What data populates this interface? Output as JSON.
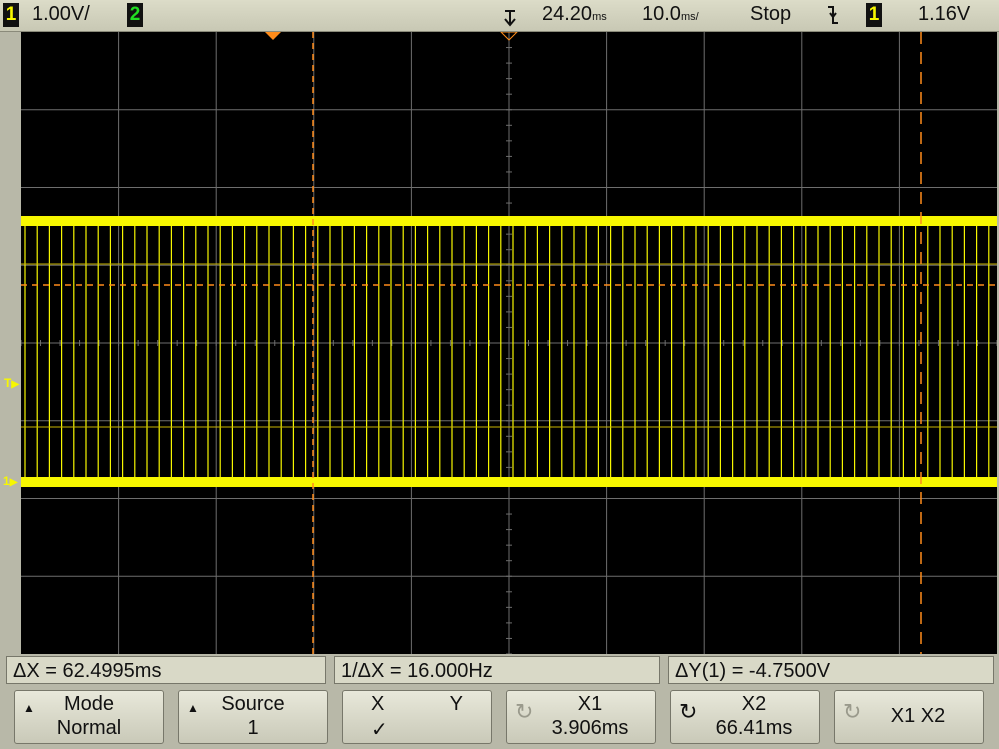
{
  "topbar": {
    "ch1_number": "1",
    "ch1_scale": "1.00V/",
    "ch2_number": "2",
    "trigger_delay": "24.20",
    "trigger_delay_unit": "ms",
    "timebase": "10.0",
    "timebase_unit": "ms/",
    "run_state": "Stop",
    "trigger_source": "1",
    "trigger_level": "1.16V"
  },
  "screen": {
    "trigger_marker": "T",
    "ground_marker": "1"
  },
  "measurements": {
    "delta_x": "ΔX = 62.4995ms",
    "inv_delta_x": "1/ΔX = 16.000Hz",
    "delta_y": "ΔY(1) = -4.7500V"
  },
  "softkeys": {
    "mode": {
      "label": "Mode",
      "value": "Normal"
    },
    "source": {
      "label": "Source",
      "value": "1"
    },
    "xy": {
      "x_label": "X",
      "y_label": "Y",
      "check": "✓"
    },
    "x1": {
      "label": "X1",
      "value": "3.906ms"
    },
    "x2": {
      "label": "X2",
      "value": "66.41ms"
    },
    "x1x2": {
      "label": "X1 X2"
    }
  },
  "colors": {
    "trace": "#f7f700",
    "cursor": "#ff8c1a",
    "grid": "#6e6e6e"
  }
}
